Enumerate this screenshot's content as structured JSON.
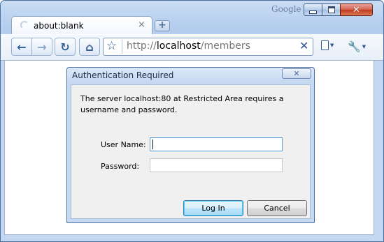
{
  "browser": {
    "brand": "Google",
    "tab": {
      "title": "about:blank",
      "close_glyph": "×"
    },
    "new_tab_glyph": "+",
    "window_controls": {
      "minimize": "minimize-icon",
      "maximize": "maximize-icon",
      "close": "✕"
    },
    "toolbar": {
      "back_glyph": "←",
      "forward_glyph": "→",
      "reload_glyph": "↻",
      "home_glyph": "⌂",
      "star_glyph": "☆",
      "url_scheme": "http://",
      "url_host": "localhost",
      "url_path": "/members",
      "stop_glyph": "✕",
      "wrench_glyph": "🔧",
      "menu_arrow": "▼"
    }
  },
  "dialog": {
    "title": "Authentication Required",
    "close_glyph": "✕",
    "message": "The server localhost:80 at Restricted Area requires a username and password.",
    "username_label": "User Name:",
    "username_value": "",
    "password_label": "Password:",
    "password_value": "",
    "login_button": "Log In",
    "cancel_button": "Cancel"
  },
  "colors": {
    "frame": "#b4cdee",
    "accent": "#2f5a95",
    "dialog_title_bar": "#c6d9f2"
  }
}
